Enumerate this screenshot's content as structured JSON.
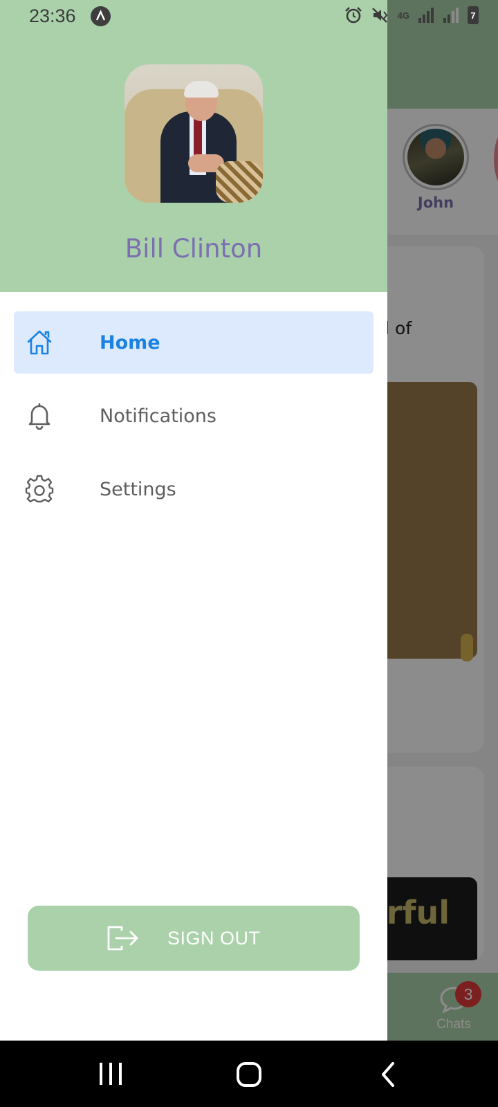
{
  "status_bar": {
    "time": "23:36",
    "network": "4G",
    "battery": "7"
  },
  "background": {
    "story_name": "John",
    "card_text": "end of",
    "image_text": "erful",
    "chats": {
      "label": "Chats",
      "badge": "3"
    }
  },
  "drawer": {
    "user_name": "Bill Clinton",
    "menu": [
      {
        "label": "Home",
        "icon": "home-icon",
        "active": true
      },
      {
        "label": "Notifications",
        "icon": "bell-icon",
        "active": false
      },
      {
        "label": "Settings",
        "icon": "gear-icon",
        "active": false
      }
    ],
    "sign_out_label": "SIGN OUT"
  },
  "colors": {
    "header_green": "#abd1ab",
    "active_item_bg": "#ddeafd",
    "active_item_text": "#1a82e0",
    "name_purple": "#7b6fb0",
    "badge_red": "#e03a3a"
  }
}
